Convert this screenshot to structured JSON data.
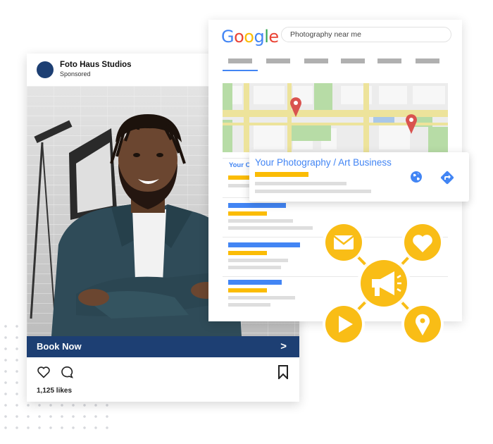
{
  "post": {
    "account_name": "Foto Haus Studios",
    "sponsored": "Sponsored",
    "cta_label": "Book Now",
    "cta_arrow": ">",
    "likes": "1,125 likes"
  },
  "search": {
    "logo": [
      "G",
      "o",
      "o",
      "g",
      "l",
      "e"
    ],
    "query": "Photography near me",
    "partial_result_label": "Your C"
  },
  "business": {
    "title": "Your Photography / Art Business"
  },
  "hub": {
    "icons": [
      "email-icon",
      "heart-icon",
      "play-icon",
      "location-pin-icon",
      "megaphone-icon"
    ]
  },
  "colors": {
    "brand_navy": "#1d3f73",
    "google_blue": "#4285f4",
    "google_red": "#ea4335",
    "google_yellow": "#fbbc05",
    "google_green": "#34a853",
    "hub_yellow": "#f9bd16",
    "map_green": "#b7dca6",
    "map_road": "#ede39b",
    "pin_red": "#d9534f"
  }
}
